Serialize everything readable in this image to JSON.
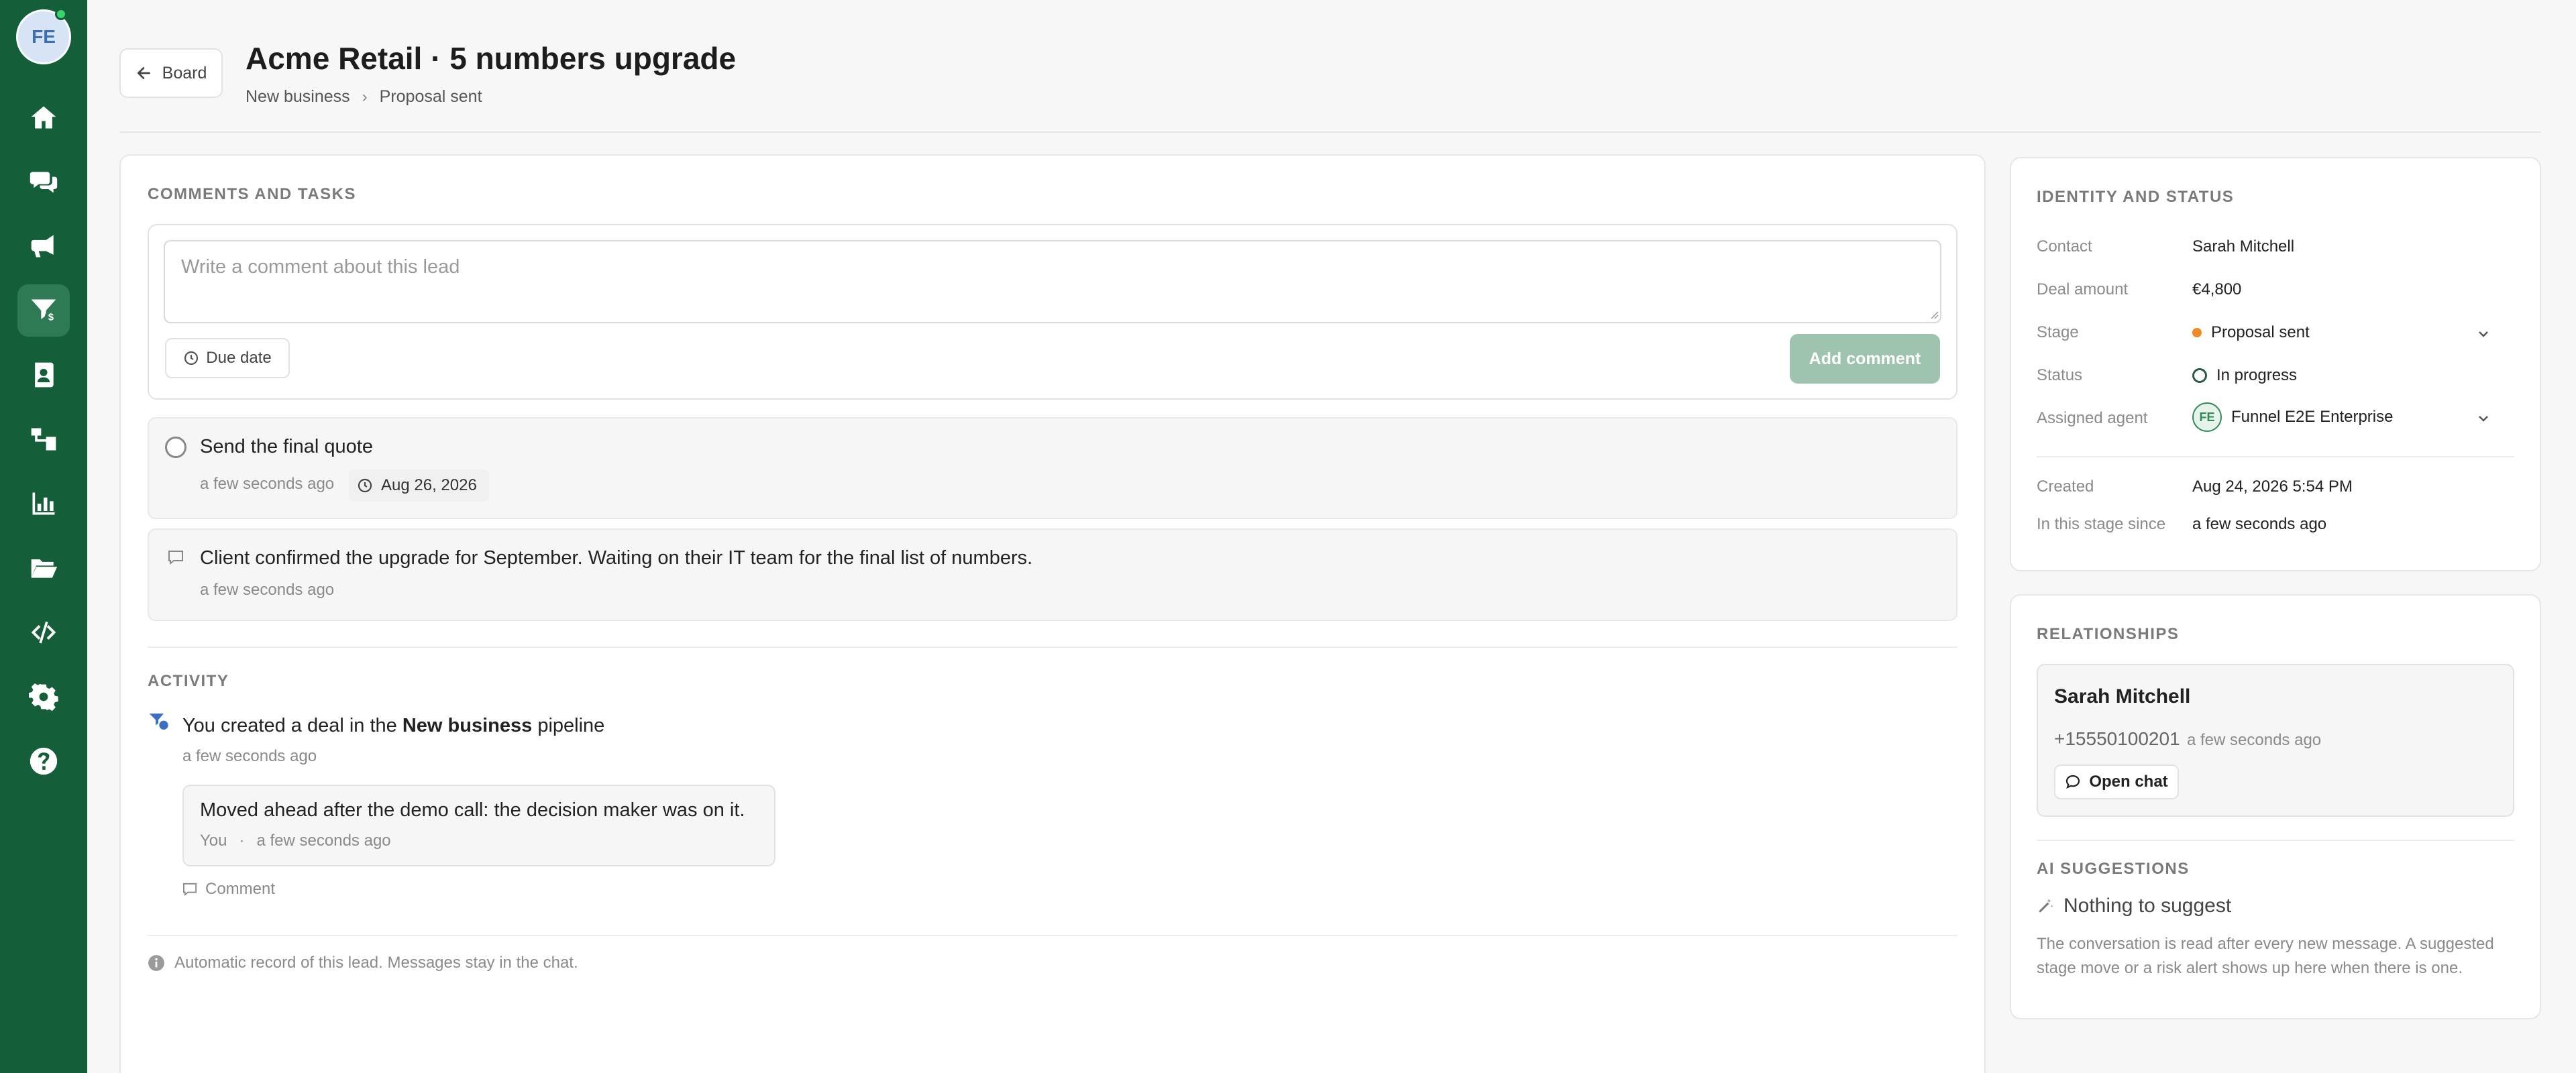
{
  "user": {
    "initials": "FE",
    "online_color": "#38d36a"
  },
  "sidebar": {
    "items": [
      {
        "icon": "home-icon",
        "active": false
      },
      {
        "icon": "chat-icon",
        "active": false
      },
      {
        "icon": "megaphone-icon",
        "active": false
      },
      {
        "icon": "funnel-icon",
        "active": true
      },
      {
        "icon": "contacts-book-icon",
        "active": false
      },
      {
        "icon": "flow-icon",
        "active": false
      },
      {
        "icon": "chart-icon",
        "active": false
      },
      {
        "icon": "folder-icon",
        "active": false
      },
      {
        "icon": "code-icon",
        "active": false
      },
      {
        "icon": "gear-icon",
        "active": false
      },
      {
        "icon": "help-icon",
        "active": false
      }
    ]
  },
  "header": {
    "back_label": "Board",
    "title": "Acme Retail · 5 numbers upgrade",
    "breadcrumb": [
      "New business",
      "Proposal sent"
    ]
  },
  "comments": {
    "section_label": "COMMENTS AND TASKS",
    "placeholder": "Write a comment about this lead",
    "due_date_label": "Due date",
    "add_label": "Add comment",
    "task": {
      "title": "Send the final quote",
      "time": "a few seconds ago",
      "due": "Aug 26, 2026"
    },
    "note": {
      "text": "Client confirmed the upgrade for September. Waiting on their IT team for the final list of numbers.",
      "time": "a few seconds ago"
    }
  },
  "activity": {
    "section_label": "ACTIVITY",
    "line_pre": "You created a deal in the ",
    "line_bold": "New business",
    "line_post": " pipeline",
    "time": "a few seconds ago",
    "note_text": "Moved ahead after the demo call: the decision maker was on it.",
    "note_author": "You",
    "note_sep": "·",
    "note_time": "a few seconds ago",
    "comment_label": "Comment",
    "footer": "Automatic record of this lead. Messages stay in the chat."
  },
  "identity": {
    "section_label": "IDENTITY AND STATUS",
    "contact_label": "Contact",
    "contact_value": "Sarah Mitchell",
    "amount_label": "Deal amount",
    "amount_value": "€4,800",
    "stage_label": "Stage",
    "stage_value": "Proposal sent",
    "stage_color": "#f08a24",
    "status_label": "Status",
    "status_value": "In progress",
    "agent_label": "Assigned agent",
    "agent_initials": "FE",
    "agent_value": "Funnel E2E Enterprise",
    "created_label": "Created",
    "created_value": "Aug 24, 2026 5:54 PM",
    "since_label": "In this stage since",
    "since_value": "a few seconds ago"
  },
  "relationships": {
    "section_label": "RELATIONSHIPS",
    "name": "Sarah Mitchell",
    "phone": "+15550100201",
    "time": "a few seconds ago",
    "open_chat_label": "Open chat"
  },
  "ai": {
    "section_label": "AI SUGGESTIONS",
    "title": "Nothing to suggest",
    "desc": "The conversation is read after every new message. A suggested stage move or a risk alert shows up here when there is one."
  },
  "colors": {
    "sidebar_bg": "#155e3a",
    "accent_green": "#2f8a57",
    "add_button_bg": "#9ec3ae"
  }
}
